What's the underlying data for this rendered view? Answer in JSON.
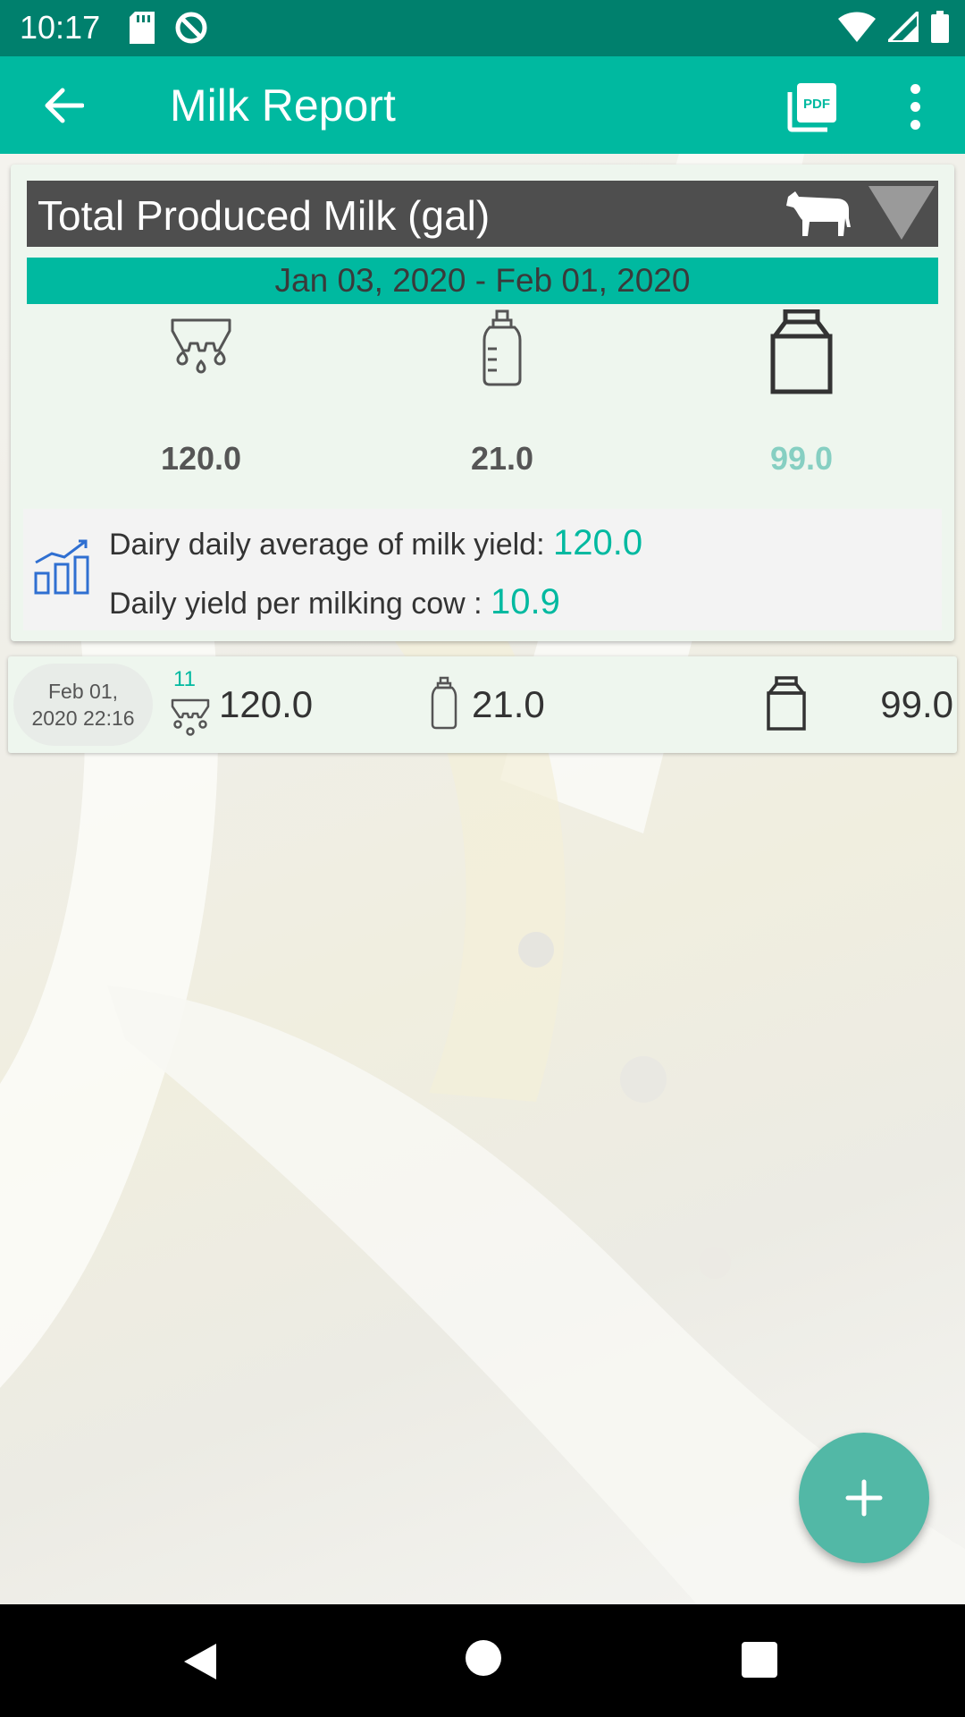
{
  "status_bar": {
    "time": "10:17"
  },
  "app_bar": {
    "title": "Milk Report"
  },
  "summary": {
    "title": "Total Produced Milk (gal)",
    "date_range": "Jan 03, 2020 - Feb 01, 2020",
    "total_value": "120.0",
    "calves_value": "21.0",
    "sold_value": "99.0",
    "avg_label": "Dairy daily average of milk yield: ",
    "avg_value": "120.0",
    "per_cow_label": "Daily yield per milking cow : ",
    "per_cow_value": "10.9"
  },
  "records": [
    {
      "date_line1": "Feb 01,",
      "date_line2": "2020 22:16",
      "cows": "11",
      "total": "120.0",
      "calves": "21.0",
      "sold": "99.0"
    }
  ],
  "colors": {
    "accent": "#00b9a0",
    "status_bar": "#00806d",
    "fab": "#52b8a6",
    "header": "#4e4e4e"
  }
}
